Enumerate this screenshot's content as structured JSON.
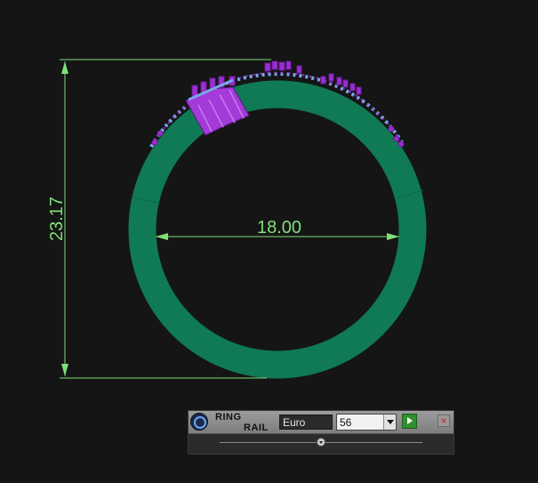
{
  "viewport": {
    "height_dimension": "23.17",
    "width_dimension": "18.00",
    "colors": {
      "background": "#151515",
      "ring_band": "#0f7a54",
      "dimension_lines": "#7fe07a",
      "gems": "#9b2fd1",
      "prongs": "#7aa6e8"
    }
  },
  "panel": {
    "title_line1": "RING",
    "title_line2": "RAIL",
    "standard": "Euro",
    "size": "56",
    "icons": {
      "logo": "ring-logo-icon",
      "dropdown": "chevron-down-icon",
      "apply": "play-icon",
      "close": "close-icon"
    }
  }
}
